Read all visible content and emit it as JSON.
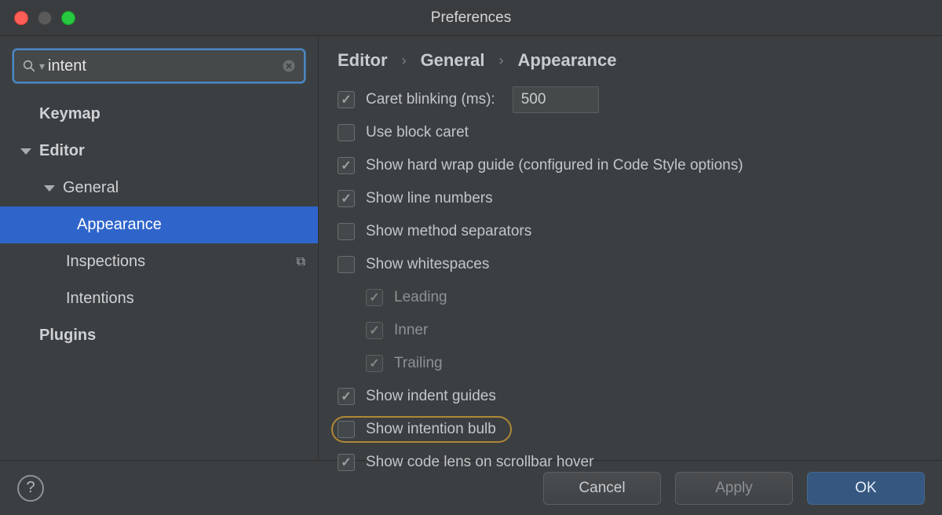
{
  "title": "Preferences",
  "search": {
    "value": "intent"
  },
  "sidebar": {
    "keymap": "Keymap",
    "editor": "Editor",
    "general": "General",
    "appearance": "Appearance",
    "inspections": "Inspections",
    "intentions": "Intentions",
    "plugins": "Plugins"
  },
  "breadcrumb": {
    "a": "Editor",
    "b": "General",
    "c": "Appearance"
  },
  "options": {
    "caret_blinking": "Caret blinking (ms):",
    "caret_value": "500",
    "use_block_caret": "Use block caret",
    "hard_wrap": "Show hard wrap guide (configured in Code Style options)",
    "line_numbers": "Show line numbers",
    "method_sep": "Show method separators",
    "whitespaces": "Show whitespaces",
    "leading": "Leading",
    "inner": "Inner",
    "trailing": "Trailing",
    "indent_guides": "Show indent guides",
    "intention_bulb": "Show intention bulb",
    "code_lens": "Show code lens on scrollbar hover"
  },
  "buttons": {
    "cancel": "Cancel",
    "apply": "Apply",
    "ok": "OK"
  }
}
